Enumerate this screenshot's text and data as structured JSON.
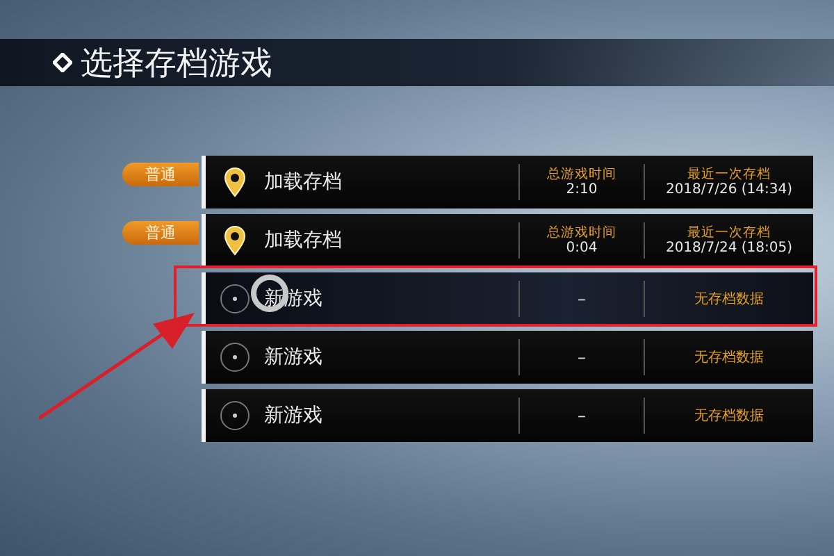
{
  "title": "选择存档游戏",
  "slots": [
    {
      "kind": "save",
      "tag": "普通",
      "name": "加载存档",
      "playtime_label": "总游戏时间",
      "playtime": "2:10",
      "last_save_label": "最近一次存档",
      "last_save": "2018/7/26 (14:34)",
      "selected": false,
      "annotated": false
    },
    {
      "kind": "save",
      "tag": "普通",
      "name": "加载存档",
      "playtime_label": "总游戏时间",
      "playtime": "0:04",
      "last_save_label": "最近一次存档",
      "last_save": "2018/7/24 (18:05)",
      "selected": false,
      "annotated": false
    },
    {
      "kind": "empty",
      "name": "新游戏",
      "playtime": "–",
      "last_save": "无存档数据",
      "selected": true,
      "annotated": true
    },
    {
      "kind": "empty",
      "name": "新游戏",
      "playtime": "–",
      "last_save": "无存档数据",
      "selected": false,
      "annotated": false
    },
    {
      "kind": "empty",
      "name": "新游戏",
      "playtime": "–",
      "last_save": "无存档数据",
      "selected": false,
      "annotated": false
    }
  ]
}
